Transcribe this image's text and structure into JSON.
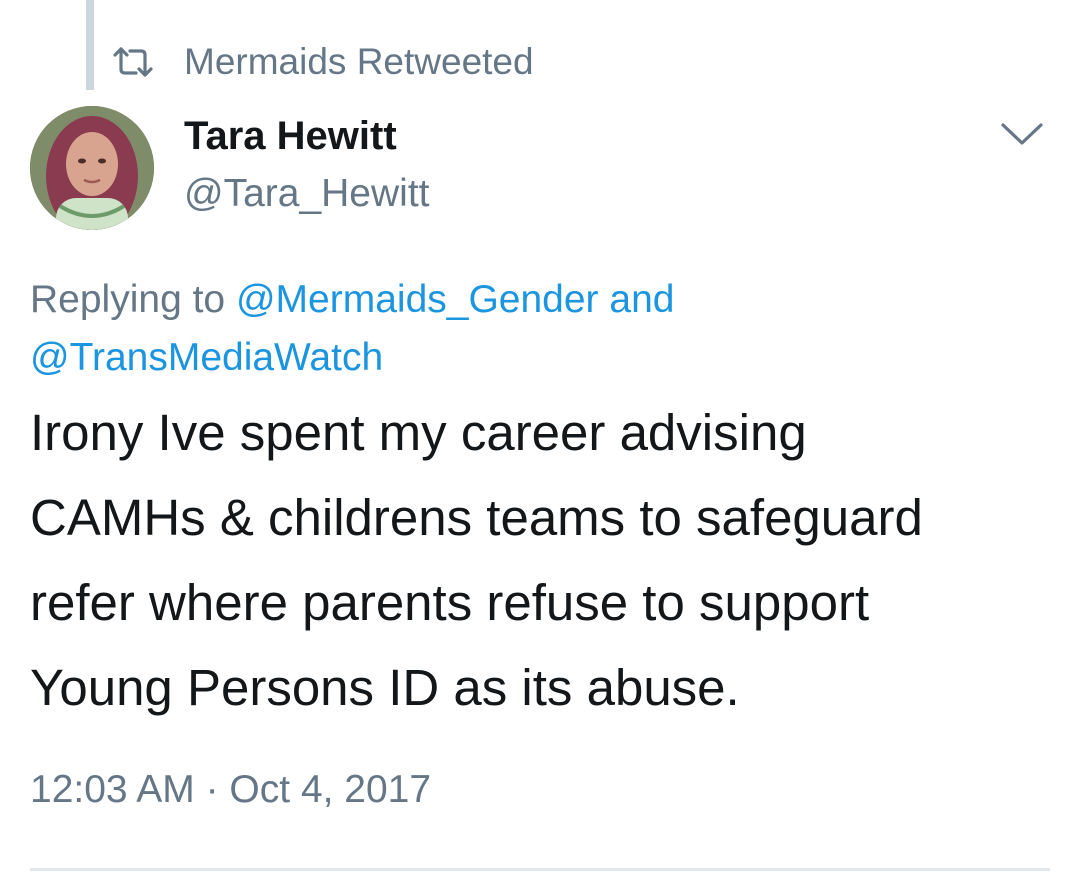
{
  "retweet_context": {
    "icon": "retweet-icon",
    "text": "Mermaids Retweeted"
  },
  "author": {
    "display_name": "Tara Hewitt",
    "handle": "@Tara_Hewitt",
    "avatar_icon": "avatar"
  },
  "menu": {
    "icon": "chevron-down-icon"
  },
  "reply": {
    "prefix": "Replying to",
    "mention_1": "@Mermaids_Gender",
    "joiner": "and",
    "mention_2": "@TransMediaWatch"
  },
  "tweet": {
    "lines": [
      "Irony Ive spent my career advising",
      "CAMHs & childrens teams to safeguard",
      "refer where parents refuse to support",
      "Young Persons ID as its abuse."
    ]
  },
  "timestamp": "12:03 AM · Oct 4, 2017",
  "colors": {
    "text_primary": "#14171a",
    "text_muted": "#657786",
    "link": "#1b95e0",
    "divider": "#e1e8ed",
    "thread_line": "#ccd6dd"
  }
}
